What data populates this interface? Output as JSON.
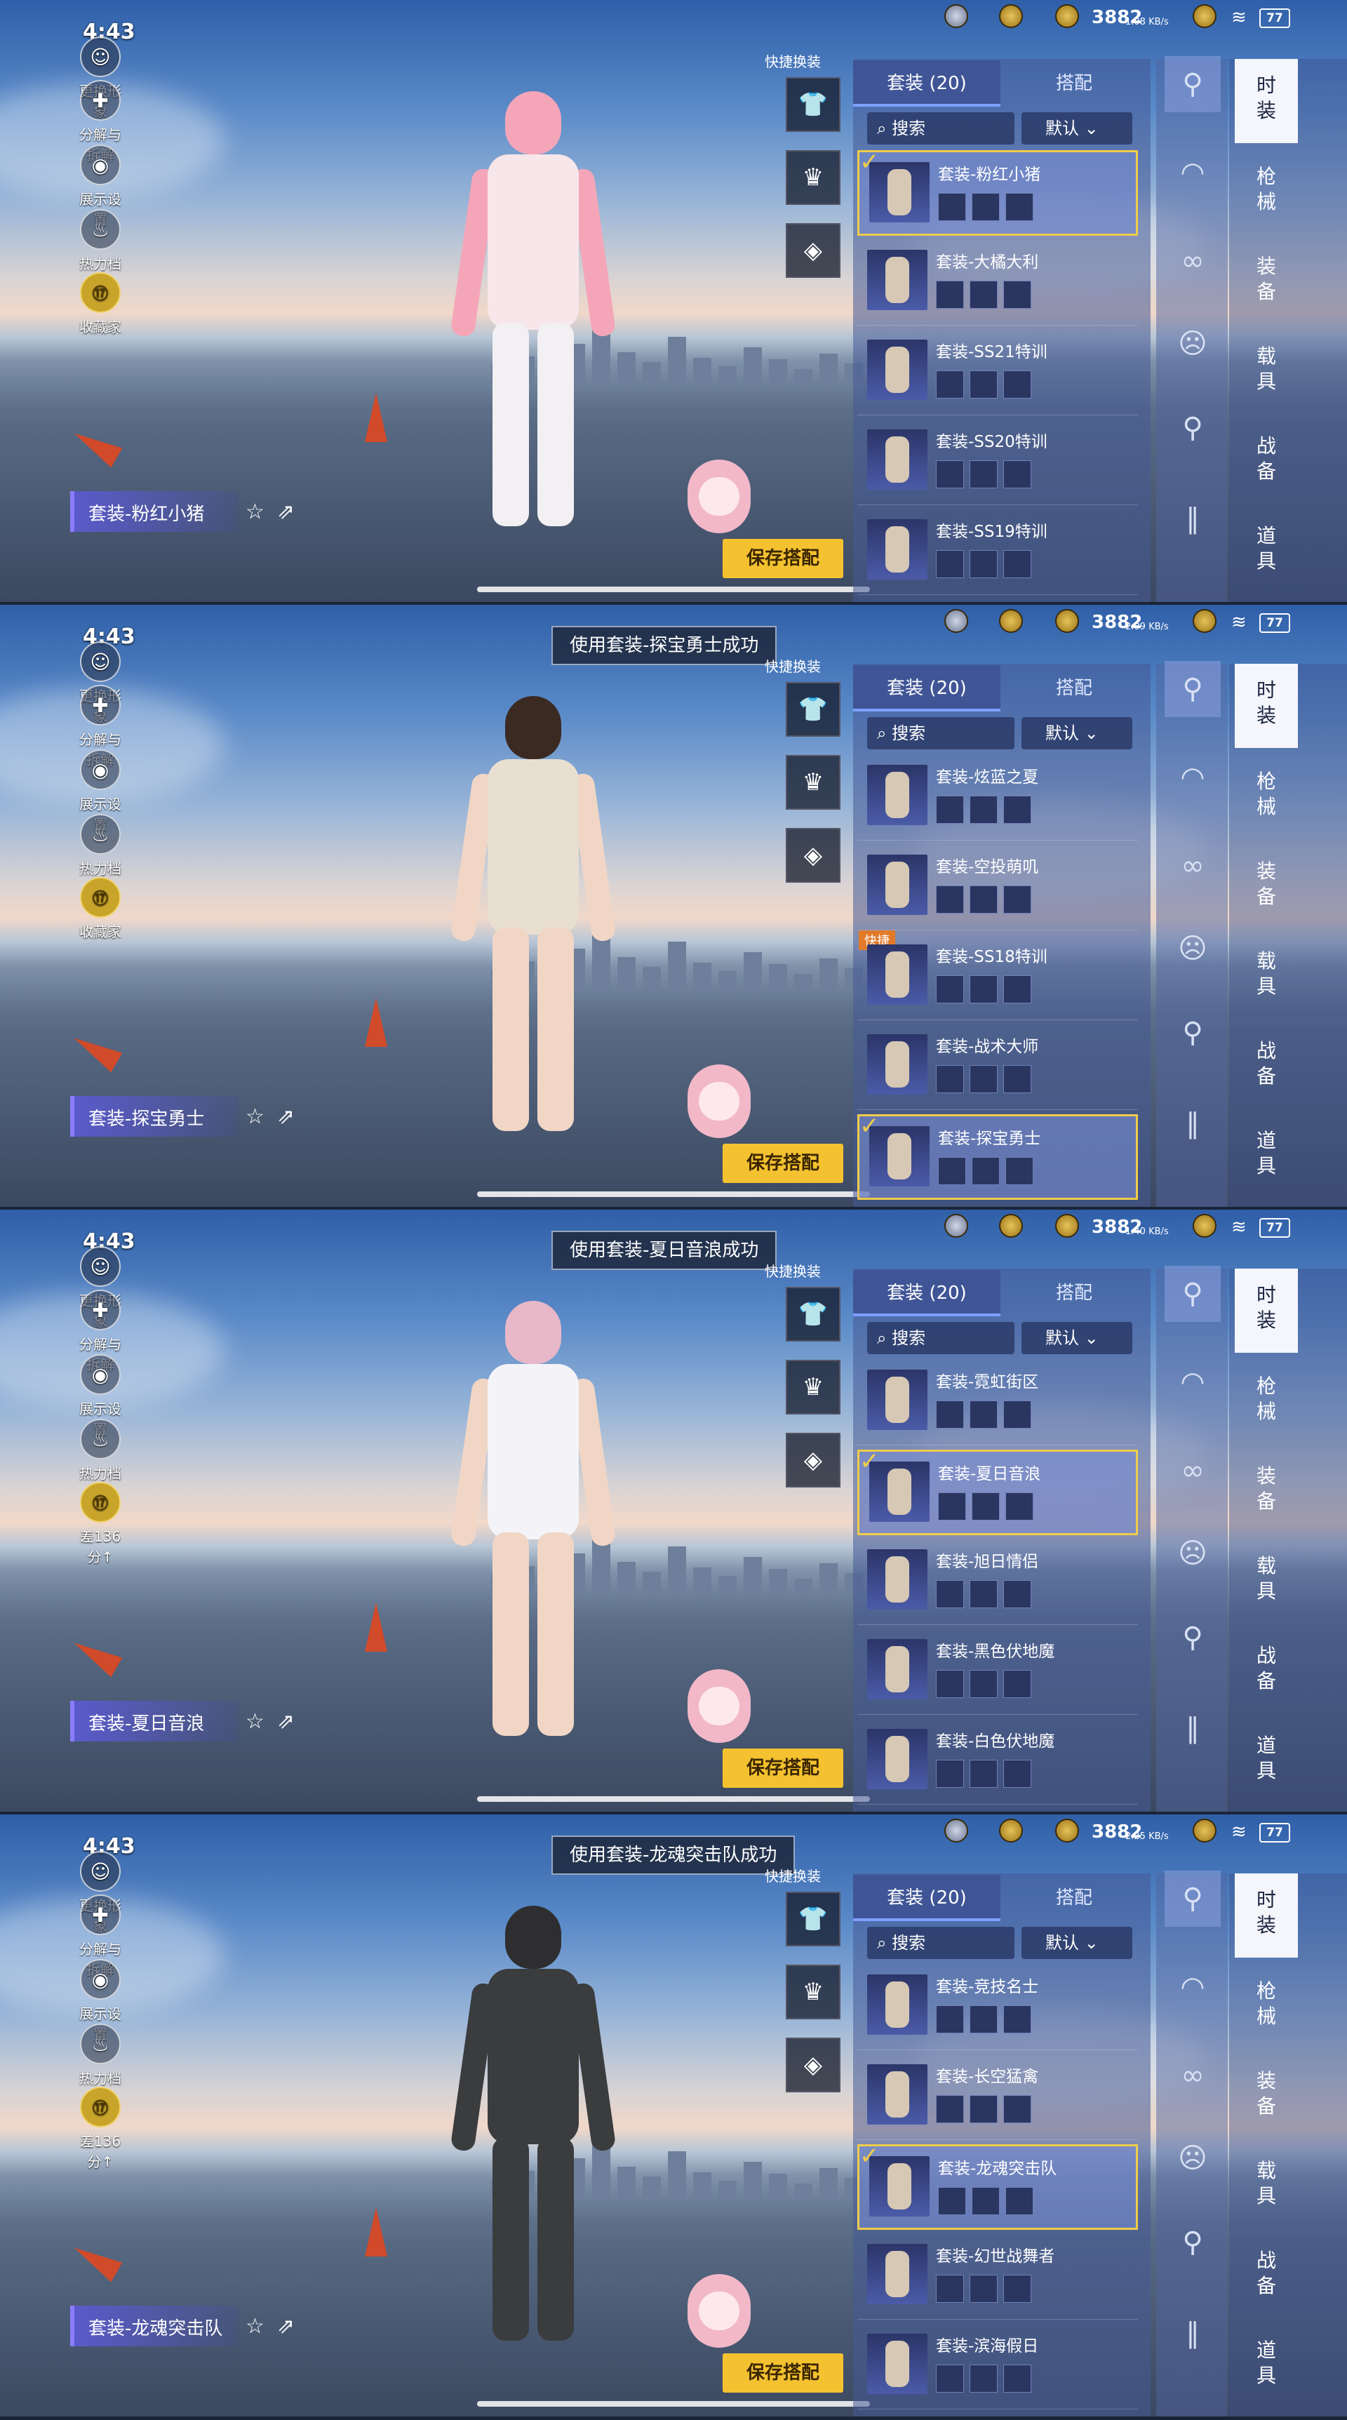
{
  "status": {
    "time": "4:43",
    "stat_value": "3882",
    "battery": "77",
    "speeds": [
      "1.08 KB/s",
      "2.09 KB/s",
      "1.40 KB/s",
      "2.25 KB/s"
    ]
  },
  "left_menu": [
    {
      "label": "更换形象",
      "icon": "person-icon"
    },
    {
      "label": "分解与拆解",
      "icon": "puzzle-icon"
    },
    {
      "label": "展示设置",
      "icon": "eye-icon"
    },
    {
      "label": "热力档案",
      "icon": "fire-icon"
    },
    {
      "label": "收藏家",
      "icon": "collector-badge-icon"
    }
  ],
  "quick_label": "快捷换装",
  "tabs": {
    "outfits": "套装 (20)",
    "match": "搭配"
  },
  "search": {
    "placeholder": "搜索",
    "sort": "默认"
  },
  "save_label": "保存搭配",
  "badge_label": "快捷",
  "score_label": "差136分↑",
  "side_tabs": [
    {
      "label": "时装"
    },
    {
      "label": "枪械"
    },
    {
      "label": "装备"
    },
    {
      "label": "载具"
    },
    {
      "label": "战备"
    },
    {
      "label": "道具"
    }
  ],
  "panels": [
    {
      "toast": "",
      "outfit_label": "套装-粉红小猪",
      "menu_last": "收藏家",
      "items": [
        {
          "name": "套装-粉红小猪",
          "selected": true,
          "badge": false
        },
        {
          "name": "套装-大橘大利",
          "selected": false,
          "badge": false
        },
        {
          "name": "套装-SS21特训",
          "selected": false,
          "badge": false
        },
        {
          "name": "套装-SS20特训",
          "selected": false,
          "badge": false
        },
        {
          "name": "套装-SS19特训",
          "selected": false,
          "badge": false
        }
      ]
    },
    {
      "toast": "使用套装-探宝勇士成功",
      "outfit_label": "套装-探宝勇士",
      "menu_last": "收藏家",
      "items": [
        {
          "name": "套装-炫蓝之夏",
          "selected": false,
          "badge": false
        },
        {
          "name": "套装-空投萌叽",
          "selected": false,
          "badge": false
        },
        {
          "name": "套装-SS18特训",
          "selected": false,
          "badge": true
        },
        {
          "name": "套装-战术大师",
          "selected": false,
          "badge": false
        },
        {
          "name": "套装-探宝勇士",
          "selected": true,
          "badge": false
        }
      ]
    },
    {
      "toast": "使用套装-夏日音浪成功",
      "outfit_label": "套装-夏日音浪",
      "menu_last": "差136分↑",
      "items": [
        {
          "name": "套装-霓虹街区",
          "selected": false,
          "badge": false
        },
        {
          "name": "套装-夏日音浪",
          "selected": true,
          "badge": false
        },
        {
          "name": "套装-旭日情侣",
          "selected": false,
          "badge": false
        },
        {
          "name": "套装-黑色伏地魔",
          "selected": false,
          "badge": false
        },
        {
          "name": "套装-白色伏地魔",
          "selected": false,
          "badge": false
        }
      ]
    },
    {
      "toast": "使用套装-龙魂突击队成功",
      "outfit_label": "套装-龙魂突击队",
      "menu_last": "差136分↑",
      "items": [
        {
          "name": "套装-竞技名士",
          "selected": false,
          "badge": false
        },
        {
          "name": "套装-长空猛禽",
          "selected": false,
          "badge": false
        },
        {
          "name": "套装-龙魂突击队",
          "selected": true,
          "badge": false
        },
        {
          "name": "套装-幻世战舞者",
          "selected": false,
          "badge": false
        },
        {
          "name": "套装-滨海假日",
          "selected": false,
          "badge": false
        }
      ]
    }
  ],
  "colors": {
    "accent": "#f4c230",
    "selected_border": "#f0cc4a",
    "panel": "#3f5596"
  }
}
